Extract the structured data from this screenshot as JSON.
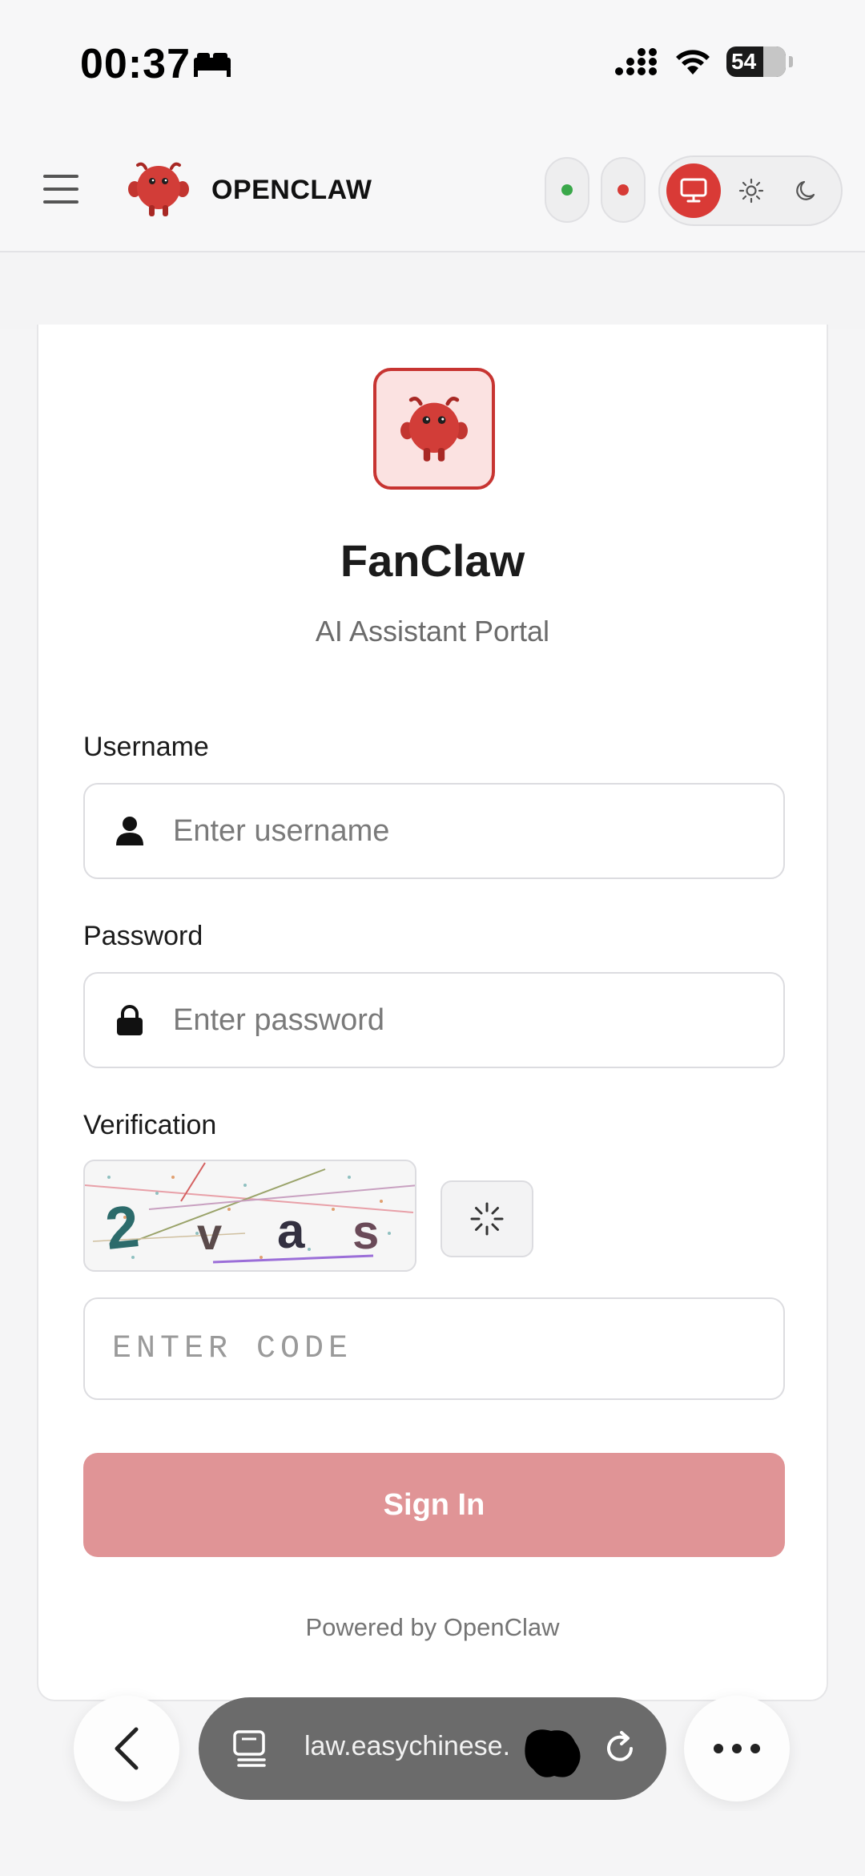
{
  "status_bar": {
    "time": "00:37",
    "battery": "54",
    "icons": [
      "bed-icon",
      "signal-icon",
      "wifi-icon",
      "battery-icon"
    ]
  },
  "header": {
    "brand": "OPENCLAW",
    "status_dots": [
      "#3aa84a",
      "#d63b36"
    ],
    "theme_options": [
      "monitor-icon",
      "sun-icon",
      "moon-icon"
    ],
    "active_theme": "system",
    "accent": "#d93a36"
  },
  "login": {
    "title": "FanClaw",
    "subtitle": "AI Assistant Portal",
    "username_label": "Username",
    "username_placeholder": "Enter username",
    "password_label": "Password",
    "password_placeholder": "Enter password",
    "verification_label": "Verification",
    "captcha_chars": [
      "2",
      "v",
      "a",
      "s"
    ],
    "code_placeholder": "ENTER CODE",
    "signin_label": "Sign In",
    "powered_by": "Powered by OpenClaw"
  },
  "browser": {
    "url": "law.easychinese."
  }
}
